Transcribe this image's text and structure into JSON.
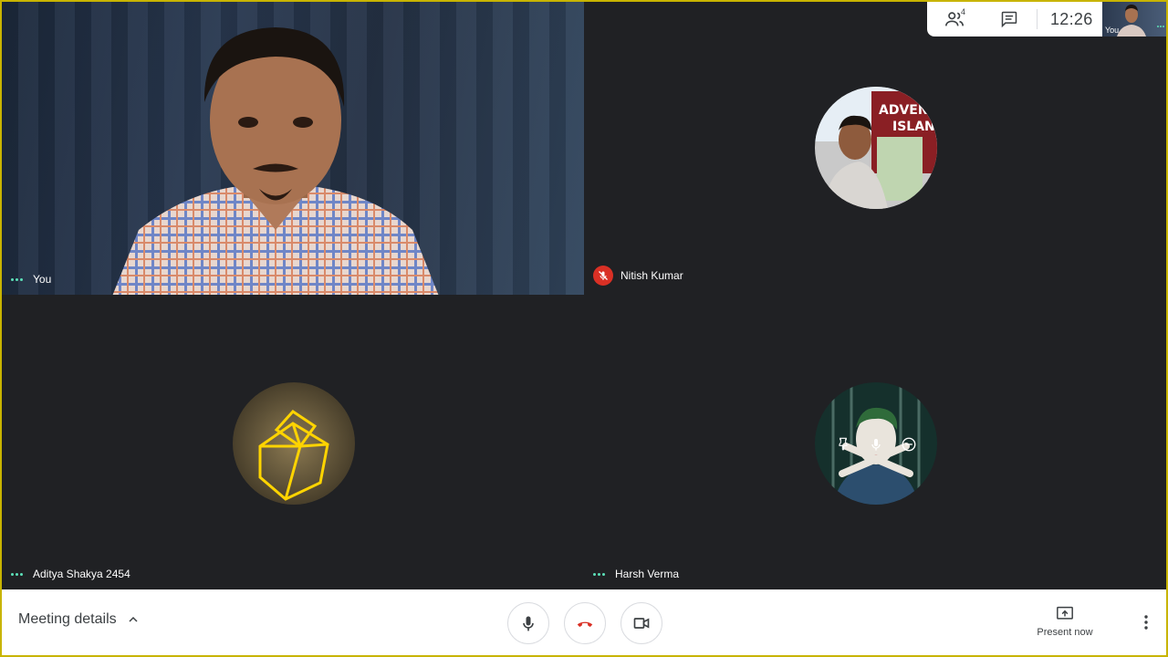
{
  "participants_count": "4",
  "clock": "12:26",
  "self_thumb_label": "You",
  "tiles": [
    {
      "name": "You",
      "state": "video"
    },
    {
      "name": "Nitish Kumar",
      "state": "avatar",
      "muted": true
    },
    {
      "name": "Aditya Shakya 2454",
      "state": "avatar"
    },
    {
      "name": "Harsh Verma",
      "state": "avatar"
    }
  ],
  "bottom": {
    "meeting_details": "Meeting details",
    "present_now": "Present now"
  },
  "icons": {
    "people": "people-icon",
    "chat": "chat-icon",
    "mic": "mic-icon",
    "hangup": "hangup-icon",
    "camera": "camera-icon",
    "present": "present-icon",
    "more": "more-vert-icon",
    "pin": "pin-icon",
    "remove": "remove-icon"
  },
  "colors": {
    "stage": "#202124",
    "muted_red": "#d93025",
    "hangup_red": "#d93025",
    "active_dots": "#5ce0b8",
    "frame": "#c8b400"
  }
}
